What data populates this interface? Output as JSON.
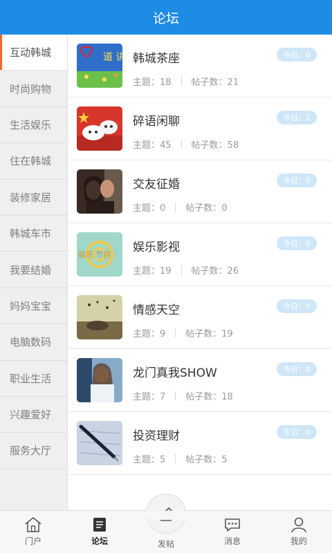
{
  "header": {
    "title": "论坛"
  },
  "sidebar": {
    "items": [
      {
        "label": "互动韩城",
        "active": true
      },
      {
        "label": "时尚购物"
      },
      {
        "label": "生活娱乐"
      },
      {
        "label": "住在韩城"
      },
      {
        "label": "装修家居"
      },
      {
        "label": "韩城车市"
      },
      {
        "label": "我要结婚"
      },
      {
        "label": "妈妈宝宝"
      },
      {
        "label": "电脑数码"
      },
      {
        "label": "职业生活"
      },
      {
        "label": "兴趣爱好"
      },
      {
        "label": "服务大厅"
      }
    ]
  },
  "forums": [
    {
      "name": "韩城茶座",
      "today": "今日：0",
      "topics": "主题：18",
      "posts": "帖子数：21",
      "thumb_text": "道 讲德 堂"
    },
    {
      "name": "碎语闲聊",
      "today": "今日：2",
      "topics": "主题：45",
      "posts": "帖子数：58"
    },
    {
      "name": "交友征婚",
      "today": "今日：0",
      "topics": "主题：0",
      "posts": "帖子数：0"
    },
    {
      "name": "娱乐影视",
      "today": "今日：0",
      "topics": "主题：19",
      "posts": "帖子数：26",
      "thumb_text": "娱乐 节目"
    },
    {
      "name": "情感天空",
      "today": "今日：0",
      "topics": "主题：9",
      "posts": "帖子数：19"
    },
    {
      "name": "龙门真我SHOW",
      "today": "今日：0",
      "topics": "主题：7",
      "posts": "帖子数：18"
    },
    {
      "name": "投资理财",
      "today": "今日：0",
      "topics": "主题：5",
      "posts": "帖子数：5"
    }
  ],
  "tabbar": {
    "home": "门户",
    "forum": "论坛",
    "post": "发帖",
    "messages": "消息",
    "mine": "我的"
  },
  "colors": {
    "header": "#1e8be4",
    "active_indicator": "#f06a2a",
    "badge": "#cfe6f8"
  }
}
